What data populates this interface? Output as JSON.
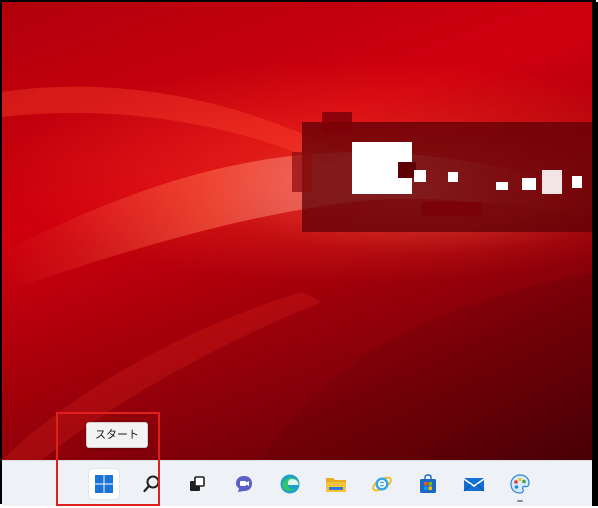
{
  "tooltip": {
    "text": "スタート"
  },
  "taskbar": {
    "icons": [
      {
        "name": "start-icon",
        "color": "#1a73d9",
        "active": true
      },
      {
        "name": "search-icon",
        "color": "#202020"
      },
      {
        "name": "task-view-icon",
        "color": "#202020"
      },
      {
        "name": "chat-icon",
        "color": "#5b5fc7"
      },
      {
        "name": "edge-icon",
        "color": "#1ea1c8"
      },
      {
        "name": "file-explorer-icon",
        "color": "#f5c33b"
      },
      {
        "name": "internet-explorer-icon",
        "color": "#35a6e8"
      },
      {
        "name": "store-icon",
        "color": "#1b66c9"
      },
      {
        "name": "mail-icon",
        "color": "#1470d2"
      },
      {
        "name": "paint-icon",
        "color": "#2b84d8"
      }
    ]
  },
  "colors": {
    "wallpaper_base": "#c4000d",
    "highlight_border": "#e0201e",
    "taskbar_bg": "#eef2f7"
  }
}
